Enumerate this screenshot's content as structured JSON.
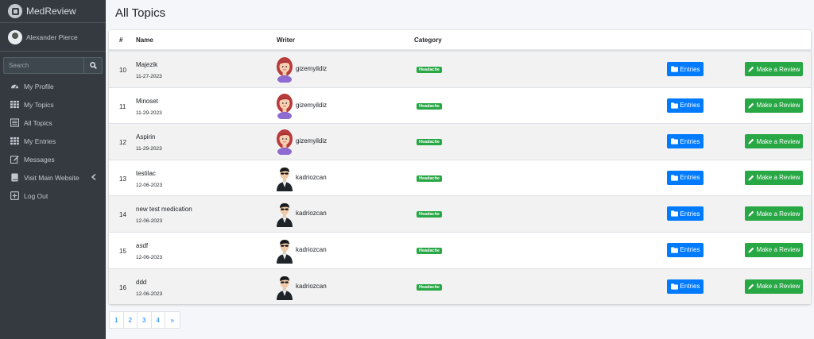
{
  "brand": {
    "name": "MedReview"
  },
  "user": {
    "name": "Alexander Pierce"
  },
  "search": {
    "placeholder": "Search"
  },
  "nav": [
    {
      "label": "My Profile",
      "icon": "dashboard-icon"
    },
    {
      "label": "My Topics",
      "icon": "grid-icon"
    },
    {
      "label": "All Topics",
      "icon": "list-icon"
    },
    {
      "label": "My Entries",
      "icon": "grid-icon"
    },
    {
      "label": "Messages",
      "icon": "edit-icon"
    },
    {
      "label": "Visit Main Website",
      "icon": "book-icon"
    },
    {
      "label": "Log Out",
      "icon": "plus-square-icon"
    }
  ],
  "page": {
    "title": "All Topics"
  },
  "table": {
    "headers": {
      "num": "#",
      "name": "Name",
      "writer": "Writer",
      "category": "Category"
    },
    "rows": [
      {
        "num": "10",
        "name": "Majezik",
        "date": "11-27-2023",
        "writer": "gizemyildiz",
        "avatar": "female",
        "category": "Headache"
      },
      {
        "num": "11",
        "name": "Minoset",
        "date": "11-29-2023",
        "writer": "gizemyildiz",
        "avatar": "female",
        "category": "Headache"
      },
      {
        "num": "12",
        "name": "Aspirin",
        "date": "11-29-2023",
        "writer": "gizemyildiz",
        "avatar": "female",
        "category": "Headache"
      },
      {
        "num": "13",
        "name": "testilac",
        "date": "12-06-2023",
        "writer": "kadriozcan",
        "avatar": "male",
        "category": "Headache"
      },
      {
        "num": "14",
        "name": "new test medication",
        "date": "12-06-2023",
        "writer": "kadriozcan",
        "avatar": "male",
        "category": "Headache"
      },
      {
        "num": "15",
        "name": "asdf",
        "date": "12-06-2023",
        "writer": "kadriozcan",
        "avatar": "male",
        "category": "Headache"
      },
      {
        "num": "16",
        "name": "ddd",
        "date": "12-06-2023",
        "writer": "kadriozcan",
        "avatar": "male",
        "category": "Headache"
      }
    ],
    "entries_label": "Entries",
    "review_label": "Make a Review"
  },
  "pagination": [
    "1",
    "2",
    "3",
    "4",
    "»"
  ],
  "colors": {
    "sidebar": "#343a40",
    "primary": "#007bff",
    "success": "#28a745"
  }
}
